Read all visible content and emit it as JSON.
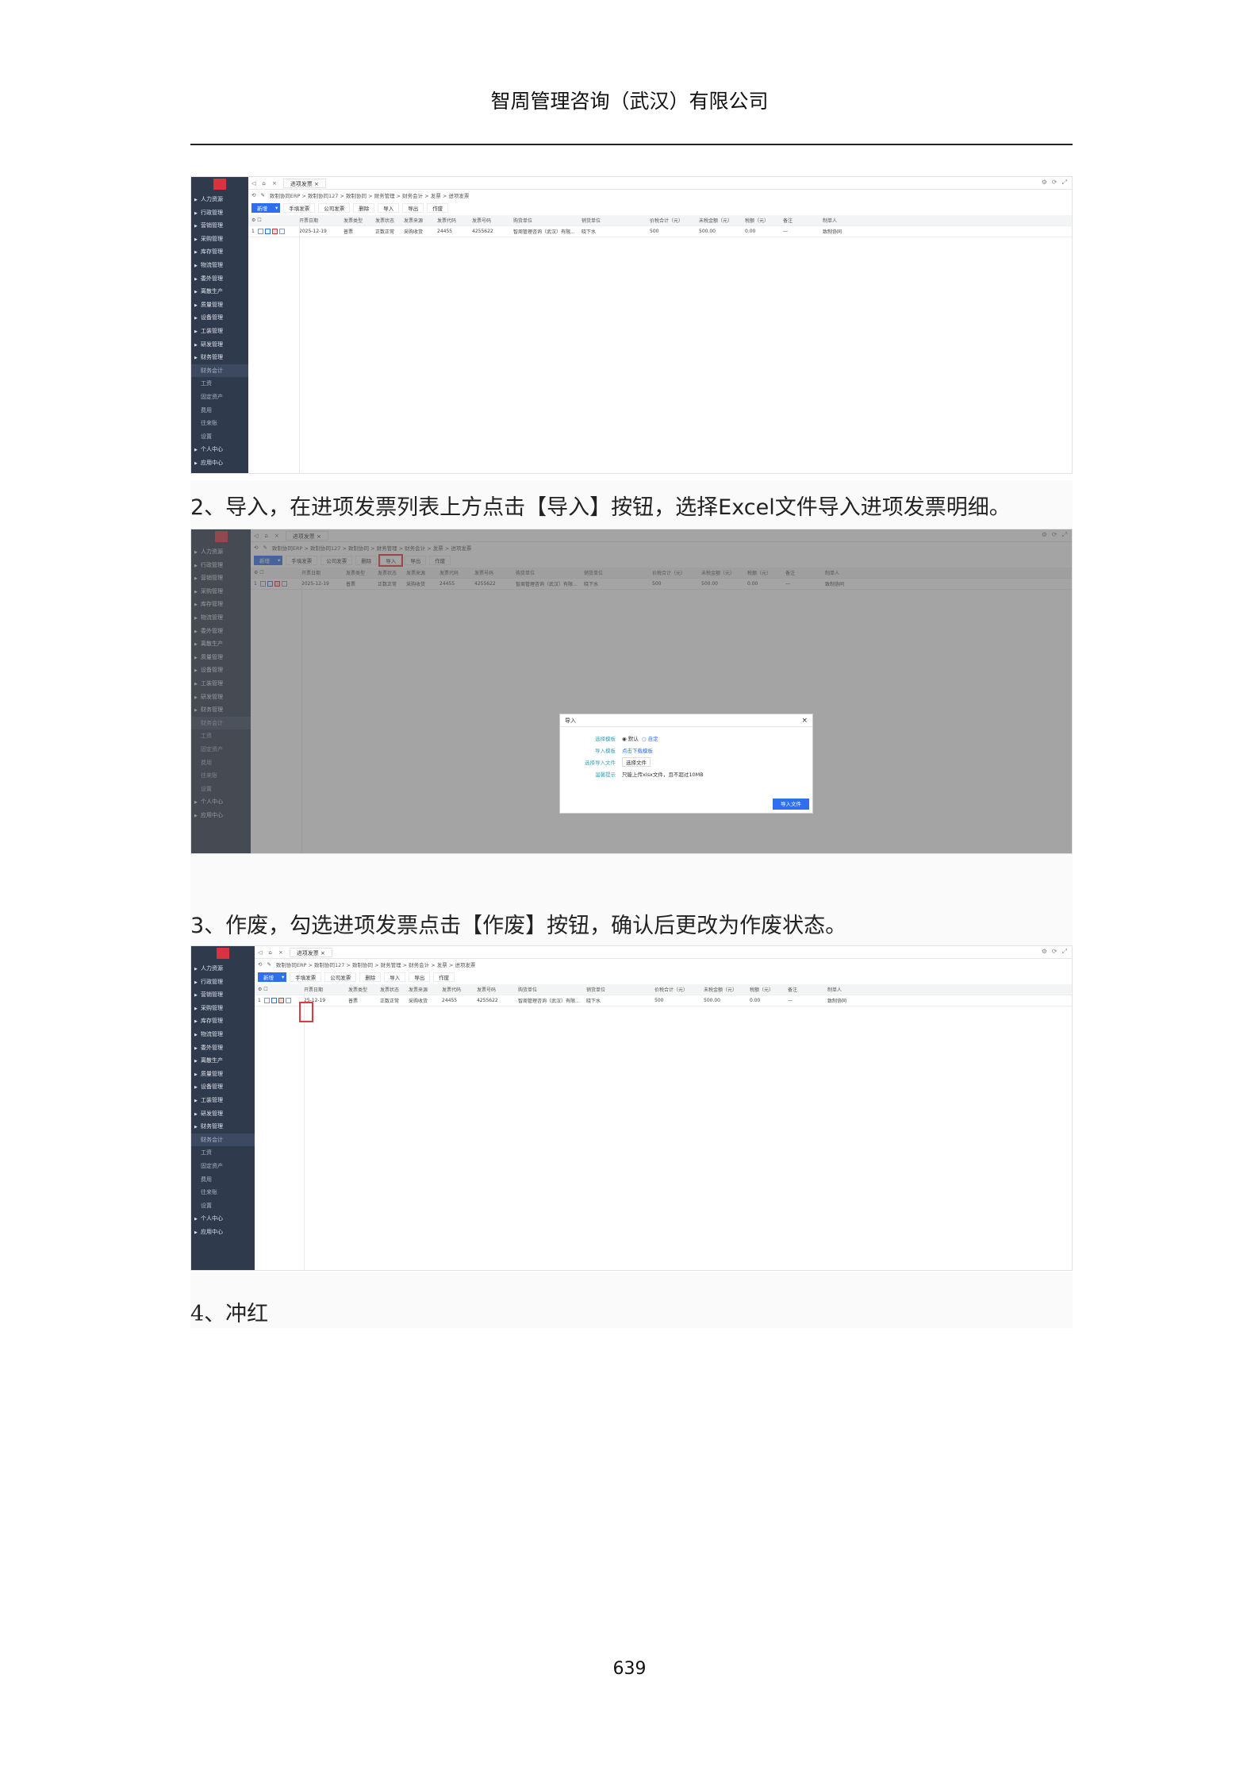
{
  "doc": {
    "header": "智周管理咨询（武汉）有限公司",
    "page_number": "639",
    "step2": "2、导入，在进项发票列表上方点击【导入】按钮，选择Excel文件导入进项发票明细。",
    "step3": "3、作废，勾选进项发票点击【作废】按钮，确认后更改为作废状态。",
    "step4": "4、冲红"
  },
  "app": {
    "tab_label": "进项发票",
    "tab_close": "×",
    "breadcrumb": "致制协同ERP > 致制协同127 > 致制协同 > 财务管理 > 财务会计 > 发票 > 进项发票",
    "sidebar": [
      {
        "label": "人力资源",
        "kind": "group"
      },
      {
        "label": "行政管理",
        "kind": "group"
      },
      {
        "label": "营销管理",
        "kind": "group"
      },
      {
        "label": "采购管理",
        "kind": "group"
      },
      {
        "label": "库存管理",
        "kind": "group"
      },
      {
        "label": "物流管理",
        "kind": "group"
      },
      {
        "label": "委外管理",
        "kind": "group"
      },
      {
        "label": "离散生产",
        "kind": "group"
      },
      {
        "label": "质量管理",
        "kind": "group"
      },
      {
        "label": "设备管理",
        "kind": "group"
      },
      {
        "label": "工装管理",
        "kind": "group"
      },
      {
        "label": "研发管理",
        "kind": "group"
      },
      {
        "label": "财务管理",
        "kind": "group"
      },
      {
        "label": "财务会计",
        "kind": "active"
      },
      {
        "label": "工资",
        "kind": "sub"
      },
      {
        "label": "固定资产",
        "kind": "sub"
      },
      {
        "label": "费用",
        "kind": "sub"
      },
      {
        "label": "往来账",
        "kind": "sub"
      },
      {
        "label": "设置",
        "kind": "sub"
      },
      {
        "label": "个人中心",
        "kind": "group"
      },
      {
        "label": "应用中心",
        "kind": "group"
      }
    ],
    "toolbar": {
      "new": "新增",
      "new_arrow": "▾",
      "manual": "手填发票",
      "sync": "公司发票",
      "delete": "删除",
      "import": "导入",
      "export": "导出",
      "void": "作废"
    },
    "columns": [
      "开票日期",
      "发票类型",
      "发票状态",
      "发票来源",
      "发票代码",
      "发票号码",
      "购货单位",
      "销货单位",
      "价税合计（元）",
      "未税金额（元）",
      "税额（元）",
      "备注",
      "制单人"
    ],
    "row": {
      "index": "1",
      "date": "2025-12-19",
      "date_partial": "25-12-19",
      "type": "普票",
      "status": "正数正常",
      "source": "采购收货",
      "code": "24455",
      "number": "4255622",
      "buyer": "智周管理咨询（武汉）有限...",
      "seller": "晓下水",
      "total": "500",
      "untaxed": "500.00",
      "tax": "0.00",
      "remark": "—",
      "creator": "致制协同"
    },
    "import_dialog": {
      "title": "导入",
      "close": "×",
      "mode_label": "选择模板",
      "mode_default": "默认",
      "mode_custom": "自定",
      "template_label": "导入模板",
      "template_link": "点击下载模板",
      "file_label": "选择导入文件",
      "file_button": "选择文件",
      "tip_label": "温馨提示",
      "tip_text": "只能上传xlsx文件，且不超过10MB",
      "submit": "导入文件"
    }
  }
}
